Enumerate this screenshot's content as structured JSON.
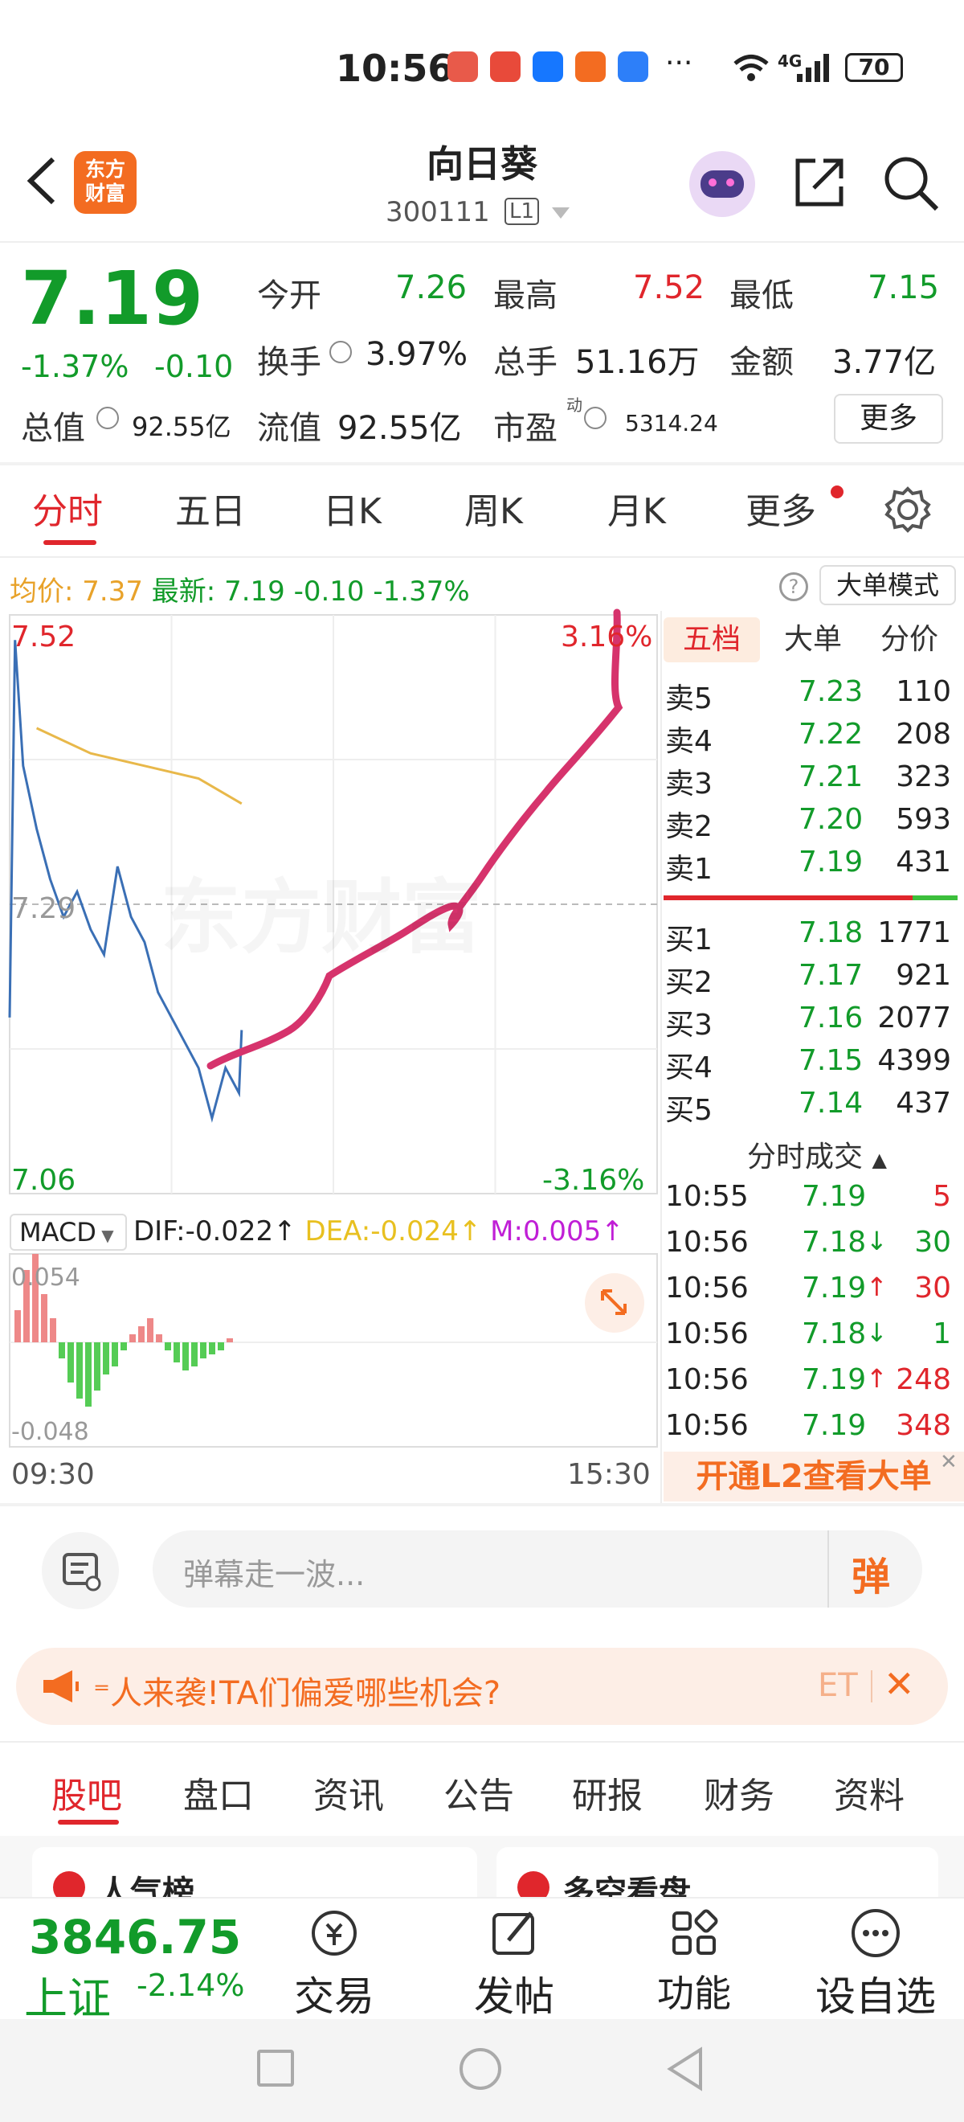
{
  "status_bar": {
    "time": "10:56",
    "battery": "70",
    "network": "4G",
    "more": "···"
  },
  "header": {
    "logo_line1": "东方",
    "logo_line2": "财富",
    "name": "向日葵",
    "code": "300111",
    "level": "L1"
  },
  "quote": {
    "price": "7.19",
    "change_pct": "-1.37%",
    "change": "-0.10",
    "open_label": "今开",
    "open": "7.26",
    "high_label": "最高",
    "high": "7.52",
    "low_label": "最低",
    "low": "7.15",
    "turnover_label": "换手",
    "turnover": "3.97%",
    "volume_label": "总手",
    "volume": "51.16万",
    "amount_label": "金额",
    "amount": "3.77亿",
    "mktcap_label": "总值",
    "mktcap": "92.55亿",
    "float_label": "流值",
    "float": "92.55亿",
    "pe_label": "市盈",
    "pe_sup": "动",
    "pe": "5314.24",
    "more_button": "更多"
  },
  "tabs": [
    "分时",
    "五日",
    "日K",
    "周K",
    "月K",
    "更多"
  ],
  "info_line": {
    "avg_label": "均价:",
    "avg": "7.37",
    "latest_label": "最新:",
    "latest": "7.19",
    "chg": "-0.10",
    "pct": "-1.37%",
    "big_order_mode": "大单模式"
  },
  "chart_labels": {
    "y_high": "7.52",
    "y_mid": "7.29",
    "y_low": "7.06",
    "pct_high": "3.16%",
    "pct_low": "-3.16%",
    "watermark": "东方财富",
    "t_start": "09:30",
    "t_end": "15:30"
  },
  "macd": {
    "label": "MACD",
    "dif": "DIF:-0.022",
    "dea": "DEA:-0.024",
    "m": "M:0.005",
    "top": "0.054",
    "bottom": "-0.048"
  },
  "orderbook": {
    "tabs": [
      "五档",
      "大单",
      "分价"
    ],
    "asks": [
      {
        "label": "卖5",
        "price": "7.23",
        "vol": "110"
      },
      {
        "label": "卖4",
        "price": "7.22",
        "vol": "208"
      },
      {
        "label": "卖3",
        "price": "7.21",
        "vol": "323"
      },
      {
        "label": "卖2",
        "price": "7.20",
        "vol": "593"
      },
      {
        "label": "卖1",
        "price": "7.19",
        "vol": "431"
      }
    ],
    "bids": [
      {
        "label": "买1",
        "price": "7.18",
        "vol": "1771"
      },
      {
        "label": "买2",
        "price": "7.17",
        "vol": "921"
      },
      {
        "label": "买3",
        "price": "7.16",
        "vol": "2077"
      },
      {
        "label": "买4",
        "price": "7.15",
        "vol": "4399"
      },
      {
        "label": "买5",
        "price": "7.14",
        "vol": "437"
      }
    ],
    "trades_title": "分时成交",
    "trades": [
      {
        "time": "10:55",
        "price": "7.19",
        "arrow": "",
        "vol": "5"
      },
      {
        "time": "10:56",
        "price": "7.18",
        "arrow": "↓",
        "vol": "30"
      },
      {
        "time": "10:56",
        "price": "7.19",
        "arrow": "↑",
        "vol": "30"
      },
      {
        "time": "10:56",
        "price": "7.18",
        "arrow": "↓",
        "vol": "1"
      },
      {
        "time": "10:56",
        "price": "7.19",
        "arrow": "↑",
        "vol": "248"
      },
      {
        "time": "10:56",
        "price": "7.19",
        "arrow": "",
        "vol": "348"
      }
    ],
    "l2_banner": "开通L2查看大单"
  },
  "danmu": {
    "placeholder": "弹幕走一波...",
    "send": "弹"
  },
  "notice": {
    "text": "⁼人来袭!TA们偏爱哪些机会?",
    "tag": "ET"
  },
  "bottom_tabs": [
    "股吧",
    "盘口",
    "资讯",
    "公告",
    "研报",
    "财务",
    "资料"
  ],
  "cards": [
    "人气榜",
    "多空看盘"
  ],
  "index": {
    "value": "3846.75",
    "name": "上证",
    "pct": "-2.14%"
  },
  "nav": [
    "交易",
    "发帖",
    "功能",
    "设自选"
  ],
  "colors": {
    "red": "#e0262c",
    "green": "#129b2a",
    "orange": "#f36c21",
    "pink": "#d6336c",
    "price_line": "#3a6fb5",
    "avg_line": "#e8b84a"
  },
  "chart_data": {
    "type": "line",
    "title": "",
    "xlabel": "",
    "ylabel": "",
    "ylim": [
      7.06,
      7.52
    ],
    "x_range": [
      "09:30",
      "15:30"
    ],
    "series": [
      {
        "name": "",
        "x": [
          "09:30",
          "09:32",
          "09:35",
          "09:40",
          "09:45",
          "09:50",
          "09:55",
          "10:00",
          "10:05",
          "10:10",
          "10:15",
          "10:20",
          "10:25",
          "10:30",
          "10:35",
          "10:40",
          "10:45",
          "10:50",
          "10:55",
          "10:56"
        ],
        "values": [
          7.2,
          7.5,
          7.4,
          7.35,
          7.31,
          7.28,
          7.3,
          7.27,
          7.25,
          7.32,
          7.28,
          7.26,
          7.22,
          7.2,
          7.18,
          7.16,
          7.12,
          7.16,
          7.14,
          7.19
        ]
      },
      {
        "name": "",
        "x": [
          "09:40",
          "10:00",
          "10:20",
          "10:40",
          "10:56"
        ],
        "values": [
          7.43,
          7.41,
          7.4,
          7.39,
          7.37
        ]
      }
    ],
    "grid": true
  }
}
